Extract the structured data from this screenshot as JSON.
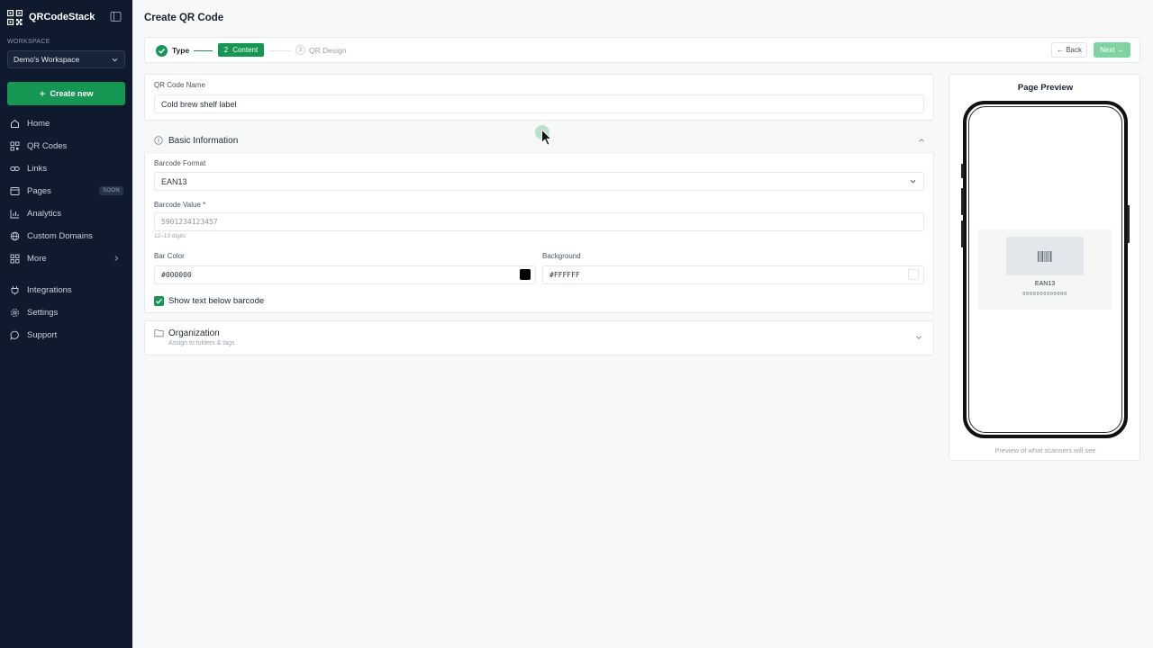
{
  "app": {
    "name": "QRCodeStack"
  },
  "sidebar": {
    "workspace_label": "WORKSPACE",
    "workspace_value": "Demo's Workspace",
    "create_label": "Create new",
    "items": [
      {
        "label": "Home",
        "icon": "home-icon"
      },
      {
        "label": "QR Codes",
        "icon": "qr-icon"
      },
      {
        "label": "Links",
        "icon": "link-icon"
      },
      {
        "label": "Pages",
        "icon": "page-icon",
        "badge": "SOON"
      },
      {
        "label": "Analytics",
        "icon": "chart-icon"
      },
      {
        "label": "Custom Domains",
        "icon": "globe-icon"
      },
      {
        "label": "More",
        "icon": "grid-icon"
      },
      {
        "label": "Integrations",
        "icon": "plug-icon"
      },
      {
        "label": "Settings",
        "icon": "gear-icon"
      },
      {
        "label": "Support",
        "icon": "chat-icon"
      }
    ]
  },
  "page": {
    "title": "Create QR Code"
  },
  "stepper": {
    "step1": "Type",
    "step2_num": "2",
    "step2": "Content",
    "step3_num": "3",
    "step3": "QR Design",
    "back": "← Back",
    "next": "Next →"
  },
  "form": {
    "name_label": "QR Code Name",
    "name_value": "Cold brew shelf label",
    "basic_title": "Basic Information",
    "format_label": "Barcode Format",
    "format_value": "EAN13",
    "value_label": "Barcode Value *",
    "value_placeholder": "5901234123457",
    "value_hint": "12–13 digits",
    "bar_color_label": "Bar Color",
    "bar_color_value": "#000000",
    "background_label": "Background",
    "background_value": "#FFFFFF",
    "show_text_label": "Show text below barcode",
    "show_text_checked": true,
    "org_title": "Organization",
    "org_subtitle": "Assign to folders & tags"
  },
  "preview": {
    "title": "Page Preview",
    "barcode_format": "EAN13",
    "barcode_digits": "0000000000000",
    "caption": "Preview of what scanners will see"
  },
  "colors": {
    "accent": "#169653",
    "sidebar_bg": "#0f1a2e"
  }
}
